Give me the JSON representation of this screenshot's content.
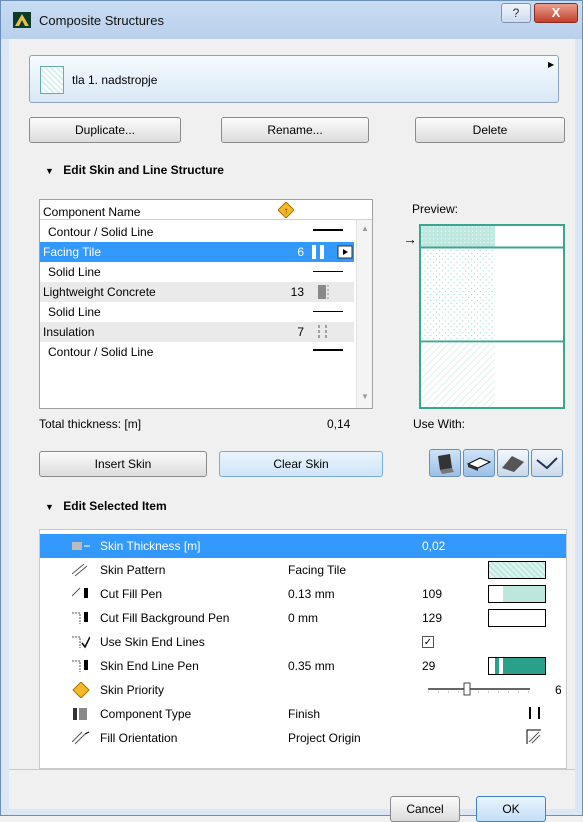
{
  "window": {
    "title": "Composite Structures",
    "help_glyph": "?",
    "close_glyph": "X"
  },
  "selector": {
    "value": "tla 1. nadstropje",
    "arrow": "▶"
  },
  "buttons": {
    "duplicate": "Duplicate...",
    "rename": "Rename...",
    "delete": "Delete"
  },
  "skin_section": {
    "title": "Edit Skin and Line Structure",
    "column_name": "Component Name",
    "rows": [
      {
        "name": "Contour / Solid Line",
        "priority": "",
        "indent": true
      },
      {
        "name": "Facing Tile",
        "priority": "6",
        "indent": false,
        "selected": true
      },
      {
        "name": "Solid Line",
        "priority": "",
        "indent": true
      },
      {
        "name": "Lightweight Concrete",
        "priority": "13",
        "indent": false
      },
      {
        "name": "Solid Line",
        "priority": "",
        "indent": true
      },
      {
        "name": "Insulation",
        "priority": "7",
        "indent": false
      },
      {
        "name": "Contour / Solid Line",
        "priority": "",
        "indent": true
      }
    ],
    "preview_label": "Preview:",
    "total_label": "Total thickness: [m]",
    "total_value": "0,14",
    "use_with_label": "Use With:",
    "insert_skin": "Insert Skin",
    "clear_skin": "Clear Skin"
  },
  "item_section": {
    "title": "Edit Selected Item",
    "rows": [
      {
        "label": "Skin Thickness [m]",
        "value": "",
        "number": "0,02",
        "icon": "thickness-icon"
      },
      {
        "label": "Skin Pattern",
        "value": "Facing Tile",
        "number": "",
        "icon": "pattern-icon"
      },
      {
        "label": "Cut Fill Pen",
        "value": "0.13 mm",
        "number": "109",
        "icon": "cut-fill-pen-icon"
      },
      {
        "label": "Cut Fill Background Pen",
        "value": "0 mm",
        "number": "129",
        "icon": "background-pen-icon"
      },
      {
        "label": "Use Skin End Lines",
        "value": "",
        "number": "✓",
        "icon": "end-lines-icon"
      },
      {
        "label": "Skin End Line Pen",
        "value": "0.35 mm",
        "number": "29",
        "icon": "end-line-pen-icon"
      },
      {
        "label": "Skin Priority",
        "value": "",
        "number": "6",
        "icon": "priority-icon"
      },
      {
        "label": "Component Type",
        "value": "Finish",
        "number": "",
        "icon": "component-type-icon"
      },
      {
        "label": "Fill Orientation",
        "value": "Project Origin",
        "number": "",
        "icon": "fill-orientation-icon"
      }
    ]
  },
  "footer": {
    "cancel": "Cancel",
    "ok": "OK"
  },
  "colors": {
    "accent": "#3399ff",
    "preview_border": "#3aa68f",
    "tile_fill": "#bde8e0"
  }
}
